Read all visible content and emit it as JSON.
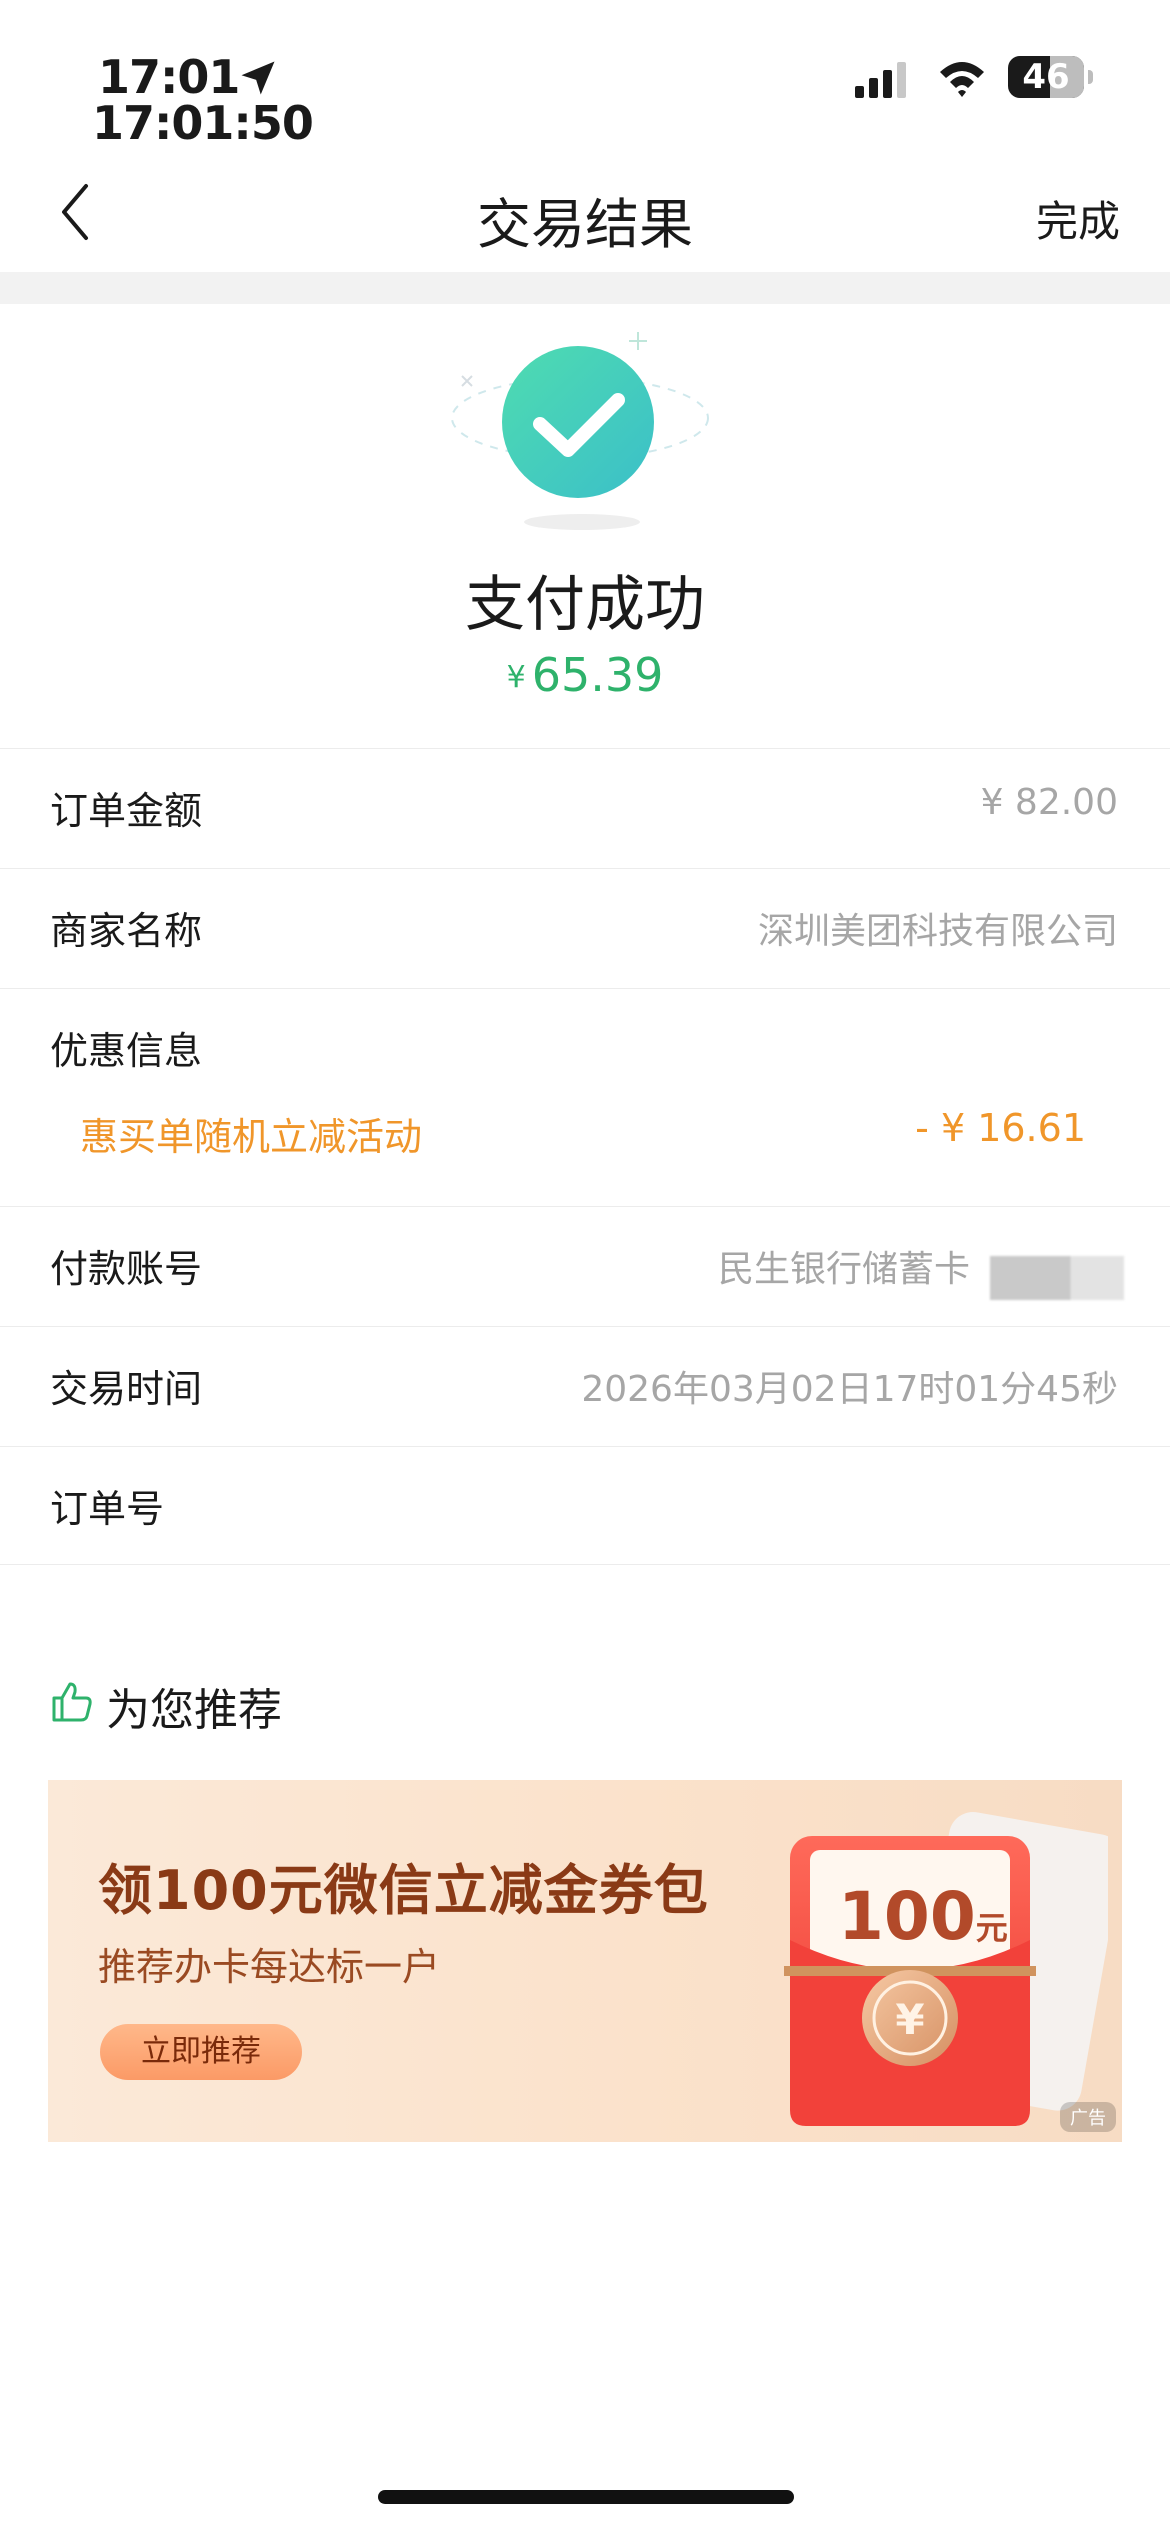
{
  "status_bar": {
    "time": "17:01",
    "time_secondary": "17:01:50",
    "battery_level": "46"
  },
  "nav": {
    "title": "交易结果",
    "done_label": "完成"
  },
  "result": {
    "status": "支付成功",
    "currency_symbol": "¥",
    "amount": "65.39"
  },
  "details": {
    "order_amount_label": "订单金额",
    "order_amount_value": "¥ 82.00",
    "merchant_label": "商家名称",
    "merchant_value": "深圳美团科技有限公司",
    "discount_label": "优惠信息",
    "discount_item_label": "惠买单随机立减活动",
    "discount_item_value": "- ¥ 16.61",
    "account_label": "付款账号",
    "account_value": "民生银行储蓄卡",
    "time_label": "交易时间",
    "time_value": "2026年03月02日17时01分45秒",
    "order_no_label": "订单号",
    "order_no_value": ""
  },
  "recommend": {
    "title": "为您推荐"
  },
  "banner": {
    "title": "领100元微信立减金券包",
    "subtitle": "推荐办卡每达标一户",
    "button_label": "立即推荐",
    "coupon_amount": "100",
    "coupon_unit": "元",
    "ad_tag": "广告"
  },
  "colors": {
    "accent_green": "#2eb26b",
    "promo_orange": "#f0962a",
    "banner_brown": "#8a3a16"
  }
}
